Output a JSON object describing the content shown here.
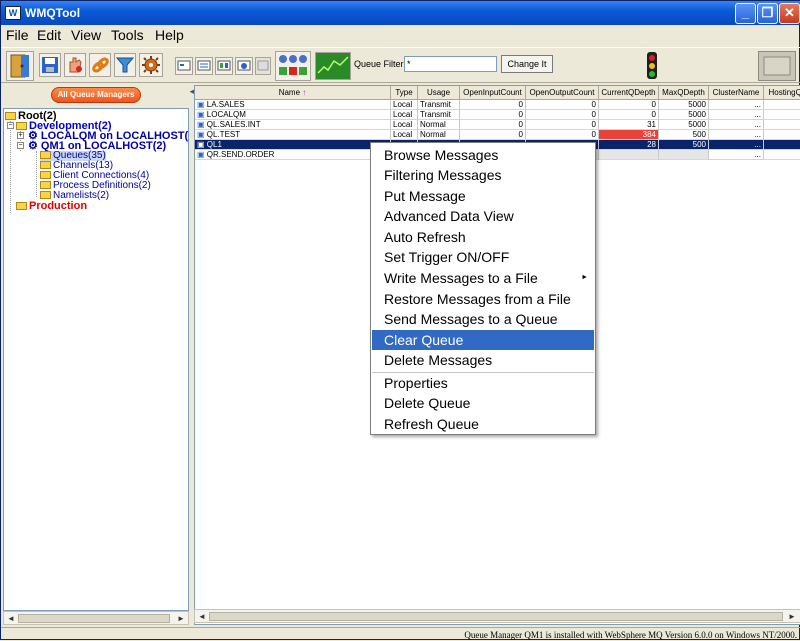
{
  "window": {
    "title": "WMQTool",
    "icon": "wmq-app-icon"
  },
  "menubar": [
    "File",
    "Edit",
    "View",
    "Tools",
    "Help"
  ],
  "toolbar": {
    "icons": [
      "exit-door-icon",
      "save-icon",
      "hand-icon",
      "link-icon",
      "filter-funnel-icon",
      "settings-gear-icon",
      "view-small-icon",
      "view-list-icon",
      "view-details-icon",
      "view-image-icon",
      "view-grid-icon",
      "status-lights-icon",
      "graph-icon",
      "traffic-light-icon",
      "panel-icon"
    ],
    "filter_label": "Queue Filter:",
    "filter_value": "*",
    "change_label": "Change It"
  },
  "left": {
    "all_qm_button": "All Queue Managers",
    "collapse_arrow": "◄",
    "tree": [
      {
        "label": "Root(2)",
        "style": "bold"
      },
      {
        "label": "Development(2)",
        "style": "bold blue"
      },
      {
        "label": "LOCALQM on LOCALHOST(1)",
        "style": "bold navy"
      },
      {
        "label": "QM1 on LOCALHOST(2)",
        "style": "bold navy"
      },
      {
        "label": "Queues(35)",
        "style": "navy sel"
      },
      {
        "label": "Channels(13)",
        "style": "navy"
      },
      {
        "label": "Client Connections(4)",
        "style": "navy"
      },
      {
        "label": "Process Definitions(2)",
        "style": "navy"
      },
      {
        "label": "Namelists(2)",
        "style": "navy"
      },
      {
        "label": "Production",
        "style": "bold red"
      }
    ]
  },
  "table": {
    "columns": [
      "Name",
      "Type",
      "Usage",
      "OpenInputCount",
      "OpenOutputCount",
      "CurrentQDepth",
      "MaxQDepth",
      "ClusterName",
      "HostingQM"
    ],
    "sort_indicator": "↑",
    "rows": [
      [
        "LA.SALES",
        "Local",
        "Transmit",
        "0",
        "0",
        "0",
        "5000",
        "...",
        ""
      ],
      [
        "LOCALQM",
        "Local",
        "Transmit",
        "0",
        "0",
        "0",
        "5000",
        "...",
        ""
      ],
      [
        "QL.SALES.INT",
        "Local",
        "Normal",
        "0",
        "0",
        "31",
        "5000",
        "...",
        ""
      ],
      [
        "QL.TEST",
        "Local",
        "Normal",
        "0",
        "0",
        "384",
        "500",
        "...",
        ""
      ],
      [
        "QL1",
        "",
        "",
        "",
        "",
        "28",
        "500",
        "...",
        ""
      ],
      [
        "QR.SEND.ORDER",
        "",
        "",
        "",
        "",
        "",
        "",
        "...",
        ""
      ]
    ]
  },
  "context_menu": {
    "items": [
      "Browse Messages",
      "Filtering Messages",
      "Put Message",
      "Advanced Data View",
      "Auto Refresh",
      "Set Trigger ON/OFF",
      "Write Messages to a File",
      "Restore Messages from a File",
      "Send Messages to a Queue",
      "Clear Queue",
      "Delete Messages",
      "Properties",
      "Delete Queue",
      "Refresh Queue"
    ],
    "highlighted": "Clear Queue",
    "submenu_arrow": "►"
  },
  "status": "Queue Manager QM1 is installed with WebSphere MQ Version 6.0.0 on Windows NT/2000."
}
